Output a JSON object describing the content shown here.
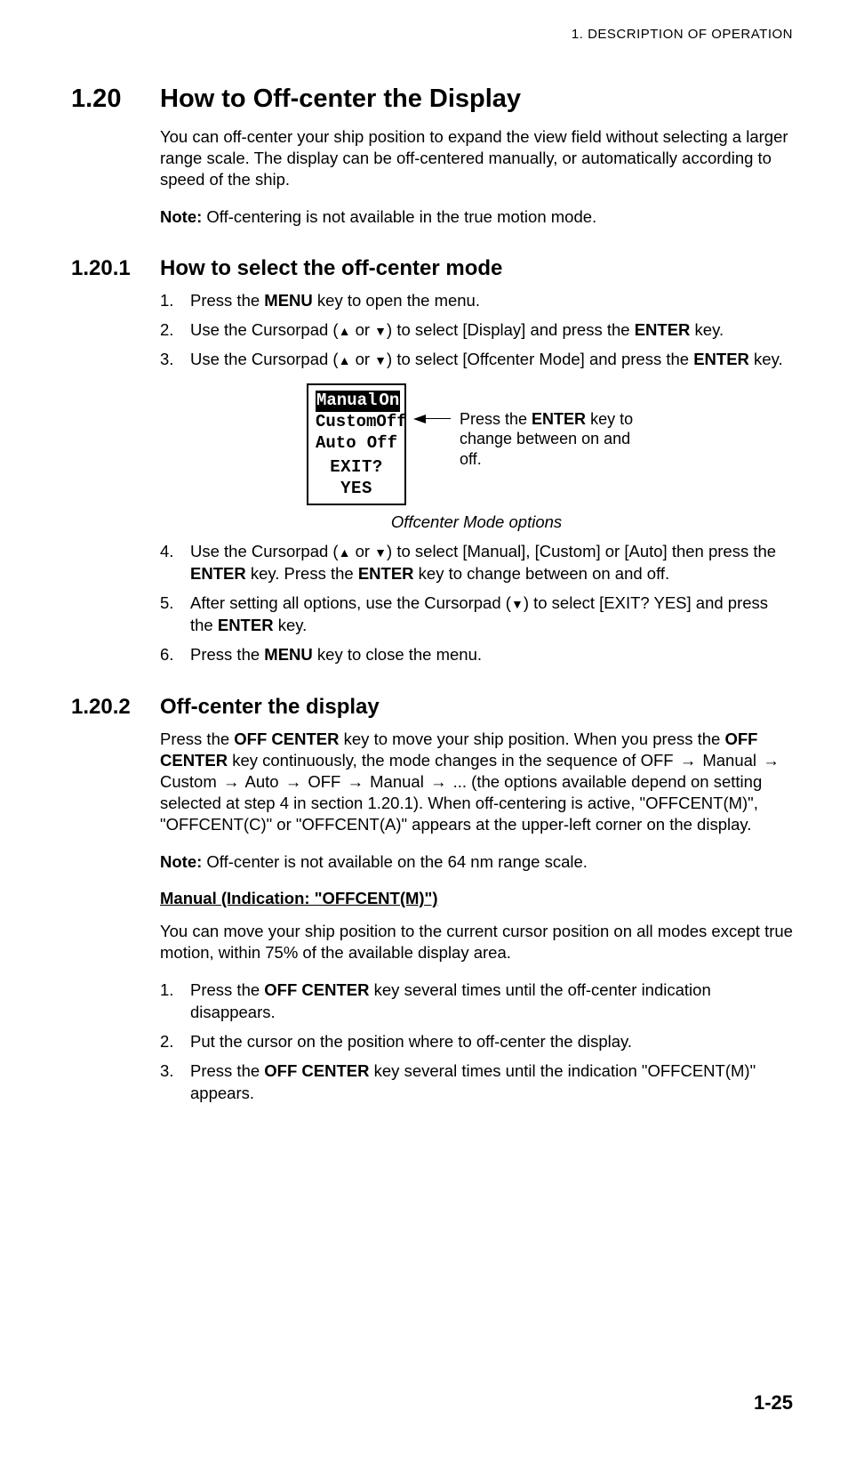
{
  "header": {
    "running": "1.  DESCRIPTION OF OPERATION"
  },
  "section": {
    "num": "1.20",
    "title": "How to Off-center the Display",
    "intro": "You can off-center your ship position to expand the view field without selecting a larger range scale. The display can be off-centered manually, or automatically according to speed of the ship.",
    "note_label": "Note:",
    "note_text": " Off-centering is not available in the true motion mode."
  },
  "sub1": {
    "num": "1.20.1",
    "title": "How to select the off-center mode",
    "steps": {
      "s1_a": "Press the ",
      "s1_b": "MENU",
      "s1_c": " key to open the menu.",
      "s2_a": "Use the Cursorpad (",
      "s2_b": " or ",
      "s2_c": ") to select [Display] and press the ",
      "s2_d": "ENTER",
      "s2_e": " key.",
      "s3_a": "Use the Cursorpad (",
      "s3_b": " or ",
      "s3_c": ") to select [Offcenter Mode] and press the ",
      "s3_d": "ENTER",
      "s3_e": " key.",
      "s4_a": "Use the Cursorpad (",
      "s4_b": " or ",
      "s4_c": ") to select [Manual], [Custom] or [Auto] then press the ",
      "s4_d": "ENTER",
      "s4_e": " key. Press the ",
      "s4_f": "ENTER",
      "s4_g": " key to change between on and off.",
      "s5_a": "After setting all options, use the Cursorpad (",
      "s5_b": ") to select [EXIT? YES] and press the ",
      "s5_c": "ENTER",
      "s5_d": " key.",
      "s6_a": "Press the ",
      "s6_b": "MENU",
      "s6_c": " key to close the menu."
    },
    "figure": {
      "rows": [
        {
          "l": "Manual",
          "r": "On"
        },
        {
          "l": "Custom",
          "r": "Off"
        },
        {
          "l": "Auto",
          "r": "Off"
        }
      ],
      "exit": "EXIT? YES",
      "callout_a": "Press the ",
      "callout_b": "ENTER",
      "callout_c": " key to change between on and off.",
      "caption": "Offcenter Mode options"
    }
  },
  "sub2": {
    "num": "1.20.2",
    "title": "Off-center the display",
    "p1_a": "Press the ",
    "p1_b": "OFF CENTER",
    "p1_c": " key to move your ship position. When you press the ",
    "p1_d": "OFF CENTER",
    "p1_e": " key continuously, the mode changes in the sequence of OFF ",
    "p1_f": " Manual ",
    "p1_g": " Custom ",
    "p1_h": " Auto ",
    "p1_i": " OFF ",
    "p1_j": " Manual ",
    "p1_k": " ... (the options available depend on setting selected at step 4 in section 1.20.1). When off-centering is active, \"OFFCENT(M)\", \"OFFCENT(C)\" or \"OFFCENT(A)\" appears at the upper-left corner on the display.",
    "note_label": "Note:",
    "note_text": " Off-center is not available on the 64 nm range scale.",
    "manual_head": "Manual (Indication: \"OFFCENT(M)\")",
    "manual_p": "You can move your ship position to the current cursor position on all modes except true motion, within 75% of the available display area.",
    "steps": {
      "s1_a": "Press the ",
      "s1_b": "OFF CENTER",
      "s1_c": " key several times until the off-center indication disappears.",
      "s2": "Put the cursor on the position where to off-center the display.",
      "s3_a": "Press the ",
      "s3_b": "OFF CENTER",
      "s3_c": " key several times until the indication \"OFFCENT(M)\" appears."
    }
  },
  "page_number": "1-25",
  "glyphs": {
    "up": "▲",
    "down": "▼",
    "rarr": "→"
  }
}
